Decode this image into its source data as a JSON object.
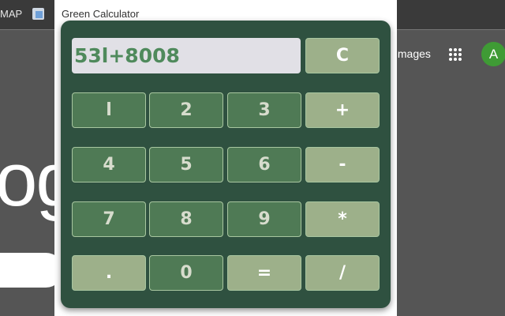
{
  "bookmarks_bar": {
    "item_label": "MAP",
    "bookmark_icon": "bookmark-page-icon"
  },
  "background_page": {
    "images_link": "Images",
    "apps_icon": "grid-apps-icon",
    "avatar_letter": "A",
    "logo_fragment": "og"
  },
  "popup": {
    "title": "Green Calculator",
    "display_value": "53l+8008",
    "clear_label": "C",
    "rows": [
      [
        "l",
        "2",
        "3",
        "+"
      ],
      [
        "4",
        "5",
        "6",
        "-"
      ],
      [
        "7",
        "8",
        "9",
        "*"
      ],
      [
        ".",
        "0",
        "=",
        "/"
      ]
    ]
  },
  "colors": {
    "panel": "#2f5140",
    "digit_button": "#4f7a55",
    "operator_button": "#9db08a",
    "display_text": "#4f8a5c"
  }
}
